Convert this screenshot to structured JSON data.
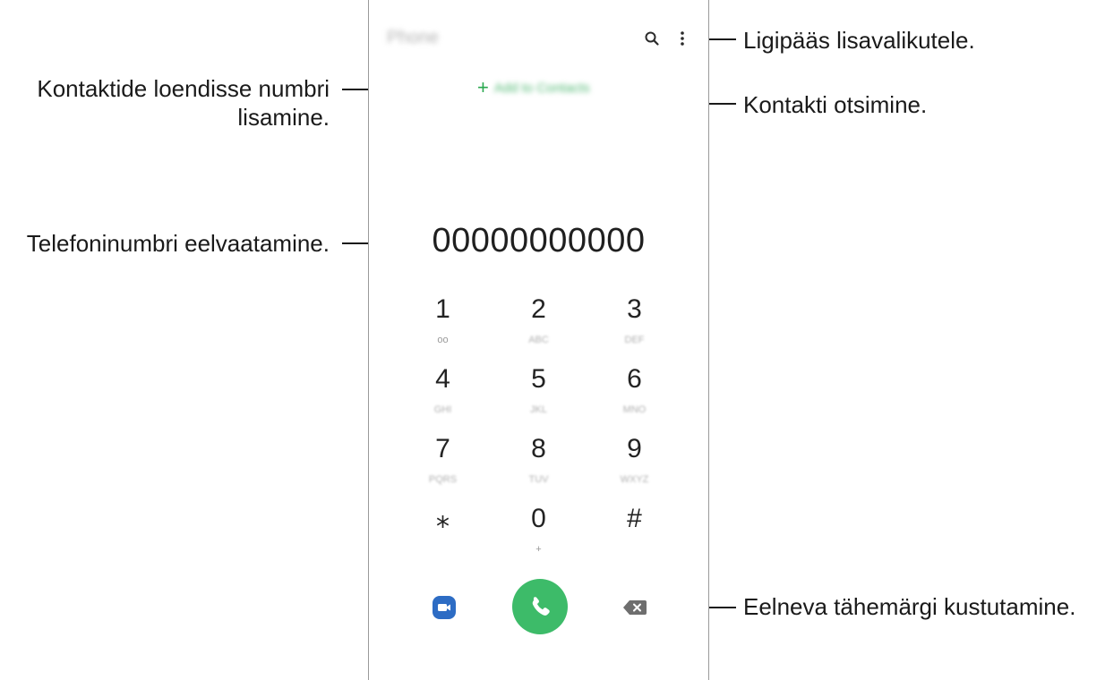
{
  "app": {
    "title": "Phone"
  },
  "toolbar": {
    "search_icon": "search-icon",
    "more_icon": "more-options-icon"
  },
  "add_contact": {
    "plus": "+",
    "label": "Add to Contacts"
  },
  "dialer": {
    "number": "00000000000",
    "keys": [
      {
        "digit": "1",
        "sub": "ᴏᴏ"
      },
      {
        "digit": "2",
        "sub": "ABC"
      },
      {
        "digit": "3",
        "sub": "DEF"
      },
      {
        "digit": "4",
        "sub": "GHI"
      },
      {
        "digit": "5",
        "sub": "JKL"
      },
      {
        "digit": "6",
        "sub": "MNO"
      },
      {
        "digit": "7",
        "sub": "PQRS"
      },
      {
        "digit": "8",
        "sub": "TUV"
      },
      {
        "digit": "9",
        "sub": "WXYZ"
      },
      {
        "digit": "⁎",
        "sub": ""
      },
      {
        "digit": "0",
        "sub": "+"
      },
      {
        "digit": "#",
        "sub": ""
      }
    ]
  },
  "bottom_actions": {
    "video_icon": "video-call-icon",
    "call_icon": "call-icon",
    "backspace_icon": "backspace-icon"
  },
  "callouts": {
    "add_number": [
      "Kontaktide loendisse numbri",
      "lisamine."
    ],
    "preview": "Telefoninumbri eelvaatamine.",
    "more_options": "Ligipääs lisavalikutele.",
    "search": "Kontakti otsimine.",
    "delete": "Eelneva tähemärgi kustutamine."
  },
  "colors": {
    "accent": "#3dbb69",
    "video": "#2d6cc4",
    "backspace": "#6e6e6e"
  }
}
